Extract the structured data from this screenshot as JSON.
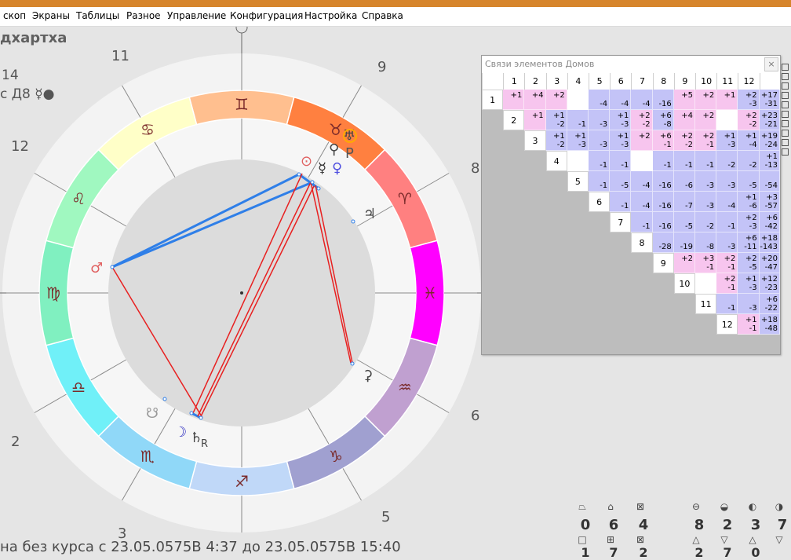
{
  "menu": [
    {
      "id": "horoscope",
      "label": "скоп"
    },
    {
      "id": "screens",
      "label": "Экраны"
    },
    {
      "id": "tables",
      "label": "Таблицы"
    },
    {
      "id": "misc",
      "label": "Разное"
    },
    {
      "id": "control",
      "label": "Управление"
    },
    {
      "id": "config",
      "label": "Конфигурация"
    },
    {
      "id": "settings",
      "label": "Настройка"
    },
    {
      "id": "help",
      "label": "Справка"
    }
  ],
  "header": {
    "title": "дхартха",
    "line2": "14",
    "line3": "с Д8 ☿●"
  },
  "houses": [
    {
      "n": "12"
    },
    {
      "n": "11"
    },
    {
      "n": "9"
    },
    {
      "n": "8"
    },
    {
      "n": "6"
    },
    {
      "n": "5"
    },
    {
      "n": "3"
    },
    {
      "n": "2"
    }
  ],
  "zodiac": [
    {
      "glyph": "♊",
      "color": "#ffbf8f"
    },
    {
      "glyph": "♉",
      "color": "#ff8040"
    },
    {
      "glyph": "♈",
      "color": "#ff8080"
    },
    {
      "glyph": "♓",
      "color": "#ff00ff"
    },
    {
      "glyph": "♒",
      "color": "#c0a0d0"
    },
    {
      "glyph": "♑",
      "color": "#a0a0d0"
    },
    {
      "glyph": "♐",
      "color": "#c0d8f8"
    },
    {
      "glyph": "♏",
      "color": "#90d8f8"
    },
    {
      "glyph": "♎",
      "color": "#70f0f8"
    },
    {
      "glyph": "♍",
      "color": "#80f0c0"
    },
    {
      "glyph": "♌",
      "color": "#a0f8c0"
    },
    {
      "glyph": "♋",
      "color": "#ffffc8"
    }
  ],
  "planets": [
    {
      "name": "uranus",
      "glyph": "♅",
      "color": "#444444"
    },
    {
      "name": "pluto",
      "glyph": "P",
      "color": "#555555"
    },
    {
      "name": "eris",
      "glyph": "⚲",
      "color": "#444444"
    },
    {
      "name": "sun",
      "glyph": "⊙",
      "color": "#e06060"
    },
    {
      "name": "mercury",
      "glyph": "☿",
      "color": "#333333"
    },
    {
      "name": "venus",
      "glyph": "♀",
      "color": "#5050e0"
    },
    {
      "name": "jupiter",
      "glyph": "♃",
      "color": "#444444"
    },
    {
      "name": "mars",
      "glyph": "♂",
      "color": "#e06060"
    },
    {
      "name": "ketu",
      "glyph": "☋",
      "color": "#999999"
    },
    {
      "name": "moon",
      "glyph": "☽",
      "color": "#3030c0"
    },
    {
      "name": "saturn",
      "glyph": "♄",
      "color": "#444444"
    },
    {
      "name": "saturn_r",
      "glyph": "R",
      "color": "#444444"
    },
    {
      "name": "proserpina",
      "glyph": "⚳",
      "color": "#444444"
    }
  ],
  "matrix": {
    "title": "Связи элементов Домов",
    "close_label": "×",
    "headers": [
      "1",
      "2",
      "3",
      "4",
      "5",
      "6",
      "7",
      "8",
      "9",
      "10",
      "11",
      "12"
    ],
    "rows": [
      [
        [
          "+1",
          ""
        ],
        [
          "+4",
          ""
        ],
        [
          "+2",
          ""
        ],
        [
          "",
          ""
        ],
        [
          "",
          "-4"
        ],
        [
          "",
          "-4"
        ],
        [
          "",
          "-4"
        ],
        [
          "",
          "-16"
        ],
        [
          "+5",
          ""
        ],
        [
          "+2",
          ""
        ],
        [
          "+1",
          ""
        ],
        [
          "+2",
          "-3"
        ],
        [
          "+17",
          "-31"
        ]
      ],
      [
        [
          "+1",
          ""
        ],
        [
          "+1",
          "-2"
        ],
        [
          "",
          "-1"
        ],
        [
          "",
          "-3"
        ],
        [
          "+1",
          "-3"
        ],
        [
          "+2",
          "-2"
        ],
        [
          "+6",
          "-8"
        ],
        [
          "+4",
          ""
        ],
        [
          "+2",
          ""
        ],
        [
          "",
          ""
        ],
        [
          "+2",
          "-2"
        ],
        [
          "+23",
          "-21"
        ]
      ],
      [
        [
          "+1",
          "-2"
        ],
        [
          "+1",
          "-3"
        ],
        [
          "",
          "-3"
        ],
        [
          "+1",
          "-3"
        ],
        [
          "+2",
          ""
        ],
        [
          "+6",
          "-1"
        ],
        [
          "+2",
          "-2"
        ],
        [
          "+2",
          "-1"
        ],
        [
          "+1",
          "-3"
        ],
        [
          "+1",
          "-4"
        ],
        [
          "+19",
          "-24"
        ]
      ],
      [
        [
          "",
          ""
        ],
        [
          "",
          "-1"
        ],
        [
          "",
          "-1"
        ],
        [
          "",
          ""
        ],
        [
          "",
          "-1"
        ],
        [
          "",
          "-1"
        ],
        [
          "",
          "-1"
        ],
        [
          "",
          "-2"
        ],
        [
          "",
          "-2"
        ],
        [
          "+1",
          "-13"
        ]
      ],
      [
        [
          "",
          "-1"
        ],
        [
          "",
          "-5"
        ],
        [
          "",
          "-4"
        ],
        [
          "",
          "-16"
        ],
        [
          "",
          "-6"
        ],
        [
          "",
          "-3"
        ],
        [
          "",
          "-3"
        ],
        [
          "",
          "-5"
        ],
        [
          "",
          "-54"
        ]
      ],
      [
        [
          "",
          "-1"
        ],
        [
          "",
          "-4"
        ],
        [
          "",
          "-16"
        ],
        [
          "",
          "-7"
        ],
        [
          "",
          "-3"
        ],
        [
          "",
          "-4"
        ],
        [
          "+1",
          "-6"
        ],
        [
          "+3",
          "-57"
        ]
      ],
      [
        [
          "",
          "-1"
        ],
        [
          "",
          "-16"
        ],
        [
          "",
          "-5"
        ],
        [
          "",
          "-2"
        ],
        [
          "",
          "-1"
        ],
        [
          "+2",
          "-3"
        ],
        [
          "+6",
          "-42"
        ]
      ],
      [
        [
          "",
          "-28"
        ],
        [
          "",
          "-19"
        ],
        [
          "",
          "-8"
        ],
        [
          "",
          "-3"
        ],
        [
          "+6",
          "-11"
        ],
        [
          "+18",
          "-143"
        ]
      ],
      [
        [
          "+2",
          ""
        ],
        [
          "+3",
          "-1"
        ],
        [
          "+2",
          "-1"
        ],
        [
          "+2",
          "-5"
        ],
        [
          "+20",
          "-47"
        ]
      ],
      [
        [
          "",
          ""
        ],
        [
          "+2",
          "-1"
        ],
        [
          "+1",
          "-3"
        ],
        [
          "+12",
          "-23"
        ]
      ],
      [
        [
          "",
          "-1"
        ],
        [
          "",
          "-3"
        ],
        [
          "+6",
          "-22"
        ]
      ],
      [
        [
          "+1",
          "-1"
        ],
        [
          "+18",
          "-48"
        ]
      ]
    ]
  },
  "counters": [
    {
      "id": "c0",
      "value": "0",
      "value2": "1"
    },
    {
      "id": "c1",
      "value": "6",
      "value2": "7"
    },
    {
      "id": "c2",
      "value": "4",
      "value2": "2"
    },
    {
      "id": "c3",
      "value": "8",
      "value2": "2"
    },
    {
      "id": "c4",
      "value": "2",
      "value2": "7"
    },
    {
      "id": "c5",
      "value": "3",
      "value2": "0"
    },
    {
      "id": "c6",
      "value": "7",
      "value2": ""
    }
  ],
  "status": "на без курса с 23.05.0575В  4:37 до 23.05.0575В 15:40"
}
